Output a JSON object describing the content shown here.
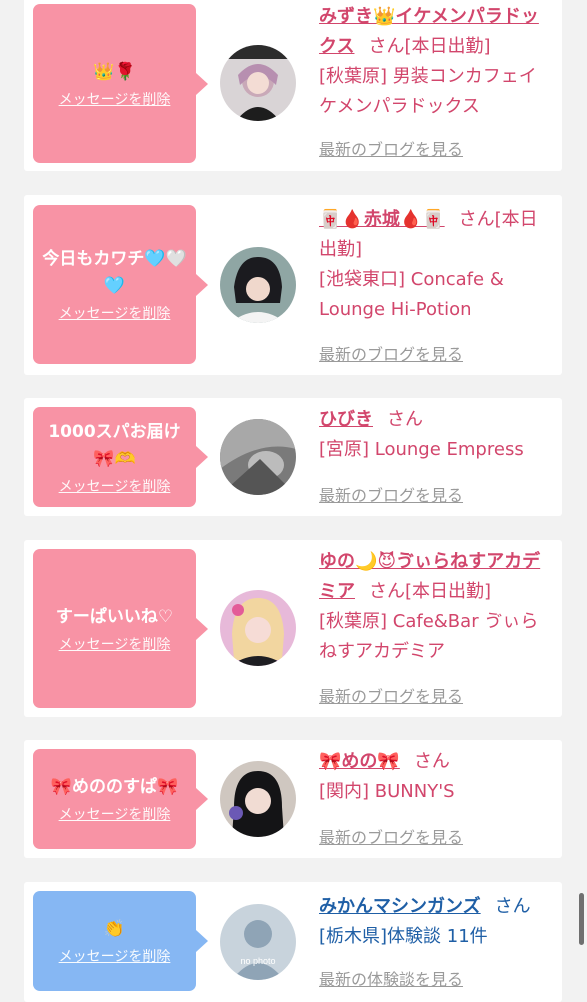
{
  "entries": [
    {
      "message": "👑🌹",
      "delete_label": "メッセージを削除",
      "name": "みずき👑イケメンパラドックス",
      "suffix": "さん",
      "status": "[本日出勤]",
      "shop": "[秋葉原] 男装コンカフェイケメンパラドックス",
      "blog_label": "最新のブログを見る",
      "bubble_color": "#f893a5"
    },
    {
      "message": "今日もカワチ🩵🤍🩵",
      "delete_label": "メッセージを削除",
      "name": "🀄🩸赤城🩸🀄",
      "suffix": "さん",
      "status": "[本日出勤]",
      "shop": "[池袋東口] Concafe & Lounge Hi-Potion",
      "blog_label": "最新のブログを見る",
      "bubble_color": "#f893a5"
    },
    {
      "message": "1000スパお届け🎀🫶",
      "delete_label": "メッセージを削除",
      "name": "ひびき",
      "suffix": "さん",
      "status": "",
      "shop": "[宮原] Lounge Empress",
      "blog_label": "最新のブログを見る",
      "bubble_color": "#f893a5"
    },
    {
      "message": "すーぱいいね♡",
      "delete_label": "メッセージを削除",
      "name": "ゆの🌙😈ゔぃらねすアカデミア",
      "suffix": "さん",
      "status": "[本日出勤]",
      "shop": "[秋葉原] Cafe&Bar ゔぃらねすアカデミア",
      "blog_label": "最新のブログを見る",
      "bubble_color": "#f893a5"
    },
    {
      "message": "🎀めののすぱ🎀",
      "delete_label": "メッセージを削除",
      "name": "🎀めの🎀",
      "suffix": "さん",
      "status": "",
      "shop": "[関内] BUNNY'S",
      "blog_label": "最新のブログを見る",
      "bubble_color": "#f893a5"
    },
    {
      "message": "👏",
      "delete_label": "メッセージを削除",
      "name": "みかんマシンガンズ",
      "suffix": "さん",
      "status": "",
      "shop": "[栃木県]体験談 11件",
      "blog_label": "最新の体験談を見る",
      "bubble_color": "#86b7f3",
      "avatar_text": "no photo"
    }
  ]
}
